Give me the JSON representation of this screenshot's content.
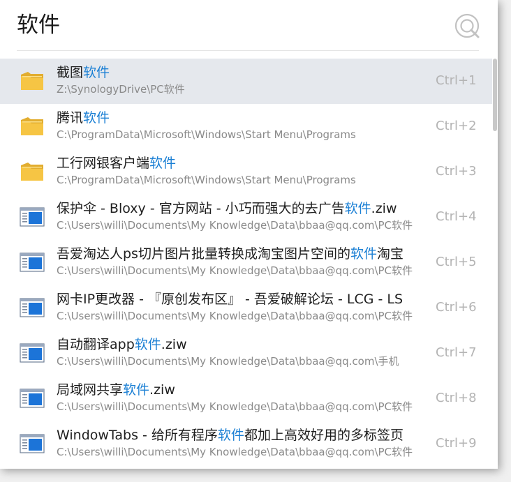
{
  "search": {
    "query": "软件"
  },
  "results": [
    {
      "kind": "folder",
      "pre": "截图",
      "hl": "软件",
      "post": "",
      "path": "Z:\\SynologyDrive\\PC软件",
      "shortcut": "Ctrl+1",
      "selected": true
    },
    {
      "kind": "folder",
      "pre": "腾讯",
      "hl": "软件",
      "post": "",
      "path": "C:\\ProgramData\\Microsoft\\Windows\\Start Menu\\Programs",
      "shortcut": "Ctrl+2",
      "selected": false
    },
    {
      "kind": "folder",
      "pre": "工行网银客户端",
      "hl": "软件",
      "post": "",
      "path": "C:\\ProgramData\\Microsoft\\Windows\\Start Menu\\Programs",
      "shortcut": "Ctrl+3",
      "selected": false
    },
    {
      "kind": "file",
      "pre": "保护伞 - Bloxy - 官方网站 - 小巧而强大的去广告",
      "hl": "软件",
      "post": ".ziw",
      "path": "C:\\Users\\willi\\Documents\\My Knowledge\\Data\\bbaa@qq.com\\PC软件",
      "shortcut": "Ctrl+4",
      "selected": false
    },
    {
      "kind": "file",
      "pre": "吾爱淘达人ps切片图片批量转换成淘宝图片空间的",
      "hl": "软件",
      "post": "淘宝",
      "path": "C:\\Users\\willi\\Documents\\My Knowledge\\Data\\bbaa@qq.com\\PC软件",
      "shortcut": "Ctrl+5",
      "selected": false
    },
    {
      "kind": "file",
      "pre": "网卡IP更改器 - 『原创发布区』 - 吾爱破解论坛 - LCG - LS",
      "hl": "",
      "post": "",
      "path": "C:\\Users\\willi\\Documents\\My Knowledge\\Data\\bbaa@qq.com\\PC软件",
      "shortcut": "Ctrl+6",
      "selected": false
    },
    {
      "kind": "file",
      "pre": "自动翻译app",
      "hl": "软件",
      "post": ".ziw",
      "path": "C:\\Users\\willi\\Documents\\My Knowledge\\Data\\bbaa@qq.com\\手机",
      "shortcut": "Ctrl+7",
      "selected": false
    },
    {
      "kind": "file",
      "pre": "局域网共享",
      "hl": "软件",
      "post": ".ziw",
      "path": "C:\\Users\\willi\\Documents\\My Knowledge\\Data\\bbaa@qq.com\\PC软件",
      "shortcut": "Ctrl+8",
      "selected": false
    },
    {
      "kind": "file",
      "pre": "WindowTabs - 给所有程序",
      "hl": "软件",
      "post": "都加上高效好用的多标签页",
      "path": "C:\\Users\\willi\\Documents\\My Knowledge\\Data\\bbaa@qq.com\\PC软件",
      "shortcut": "Ctrl+9",
      "selected": false
    }
  ],
  "colors": {
    "highlight": "#1a7fd4",
    "selected_row": "#e5e8ed",
    "folder": "#f6c544",
    "file_icon_blue": "#1c74d8"
  }
}
